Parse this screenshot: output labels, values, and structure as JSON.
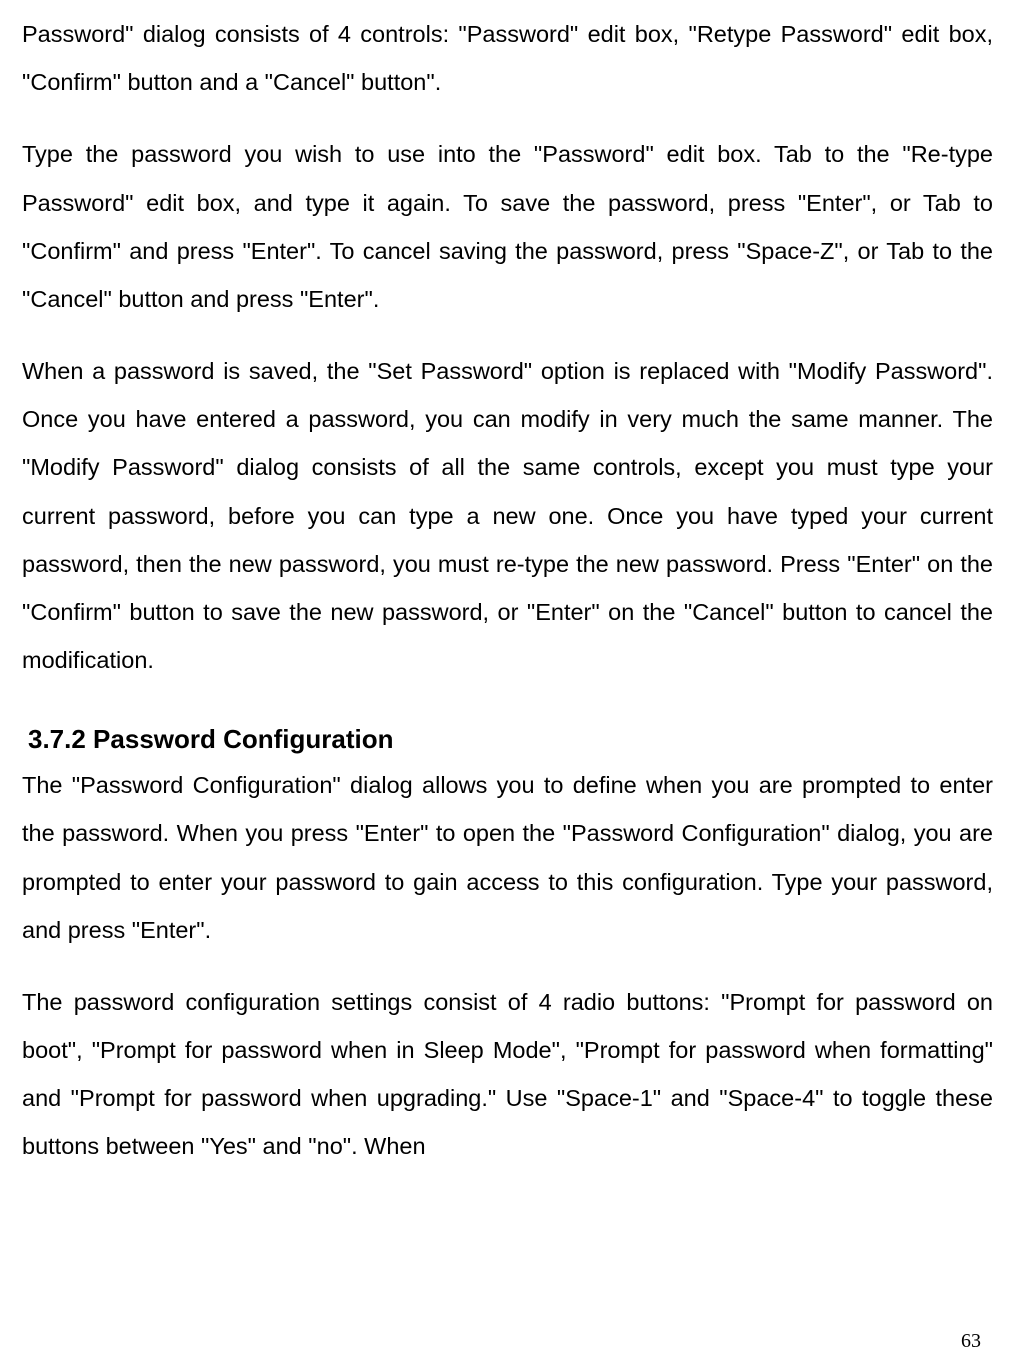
{
  "paragraphs": {
    "p1": "Password\" dialog consists of 4 controls: \"Password\" edit box, \"Retype Password\" edit box, \"Confirm\" button and a \"Cancel\" button\".",
    "p2": "Type the password you wish to use into the \"Password\" edit box. Tab to the \"Re-type Password\" edit box, and type it again. To save the password, press \"Enter\", or Tab to \"Confirm\" and press \"Enter\". To cancel saving the password, press \"Space-Z\", or Tab to the \"Cancel\" button and press \"Enter\".",
    "p3": "When a password is saved, the \"Set Password\" option is replaced with \"Modify Password\". Once you have entered a password, you can modify in very much the same manner. The \"Modify Password\" dialog consists of all the same controls, except you must type your current password, before you can type a new one. Once you have typed your current password, then the new password, you must re-type the new password. Press \"Enter\" on the \"Confirm\" button to save the new password, or \"Enter\" on the \"Cancel\" button to cancel the modification.",
    "p4": "The \"Password Configuration\" dialog allows you to define when you are prompted to enter the password. When you press \"Enter\" to open the \"Password Configuration\" dialog, you are prompted to enter your password to gain access to this configuration. Type your password, and press \"Enter\".",
    "p5": "The password configuration settings consist of 4 radio buttons: \"Prompt for password on boot\", \"Prompt for password when in Sleep Mode\", \"Prompt for password when formatting\" and \"Prompt for password when upgrading.\" Use \"Space-1\" and \"Space-4\" to toggle these buttons between \"Yes\" and \"no\". When"
  },
  "heading": "3.7.2 Password Configuration",
  "pageNumber": "63"
}
